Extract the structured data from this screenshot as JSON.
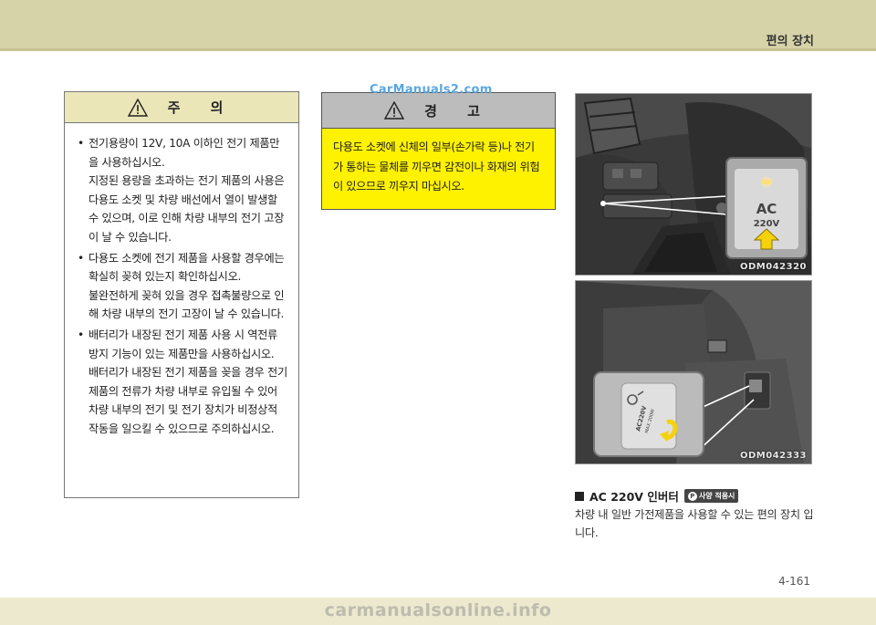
{
  "header": {
    "section_title": "편의 장치"
  },
  "caution": {
    "title": "주 의",
    "bullets": [
      {
        "paragraphs": [
          "전기용량이 12V, 10A 이하인 전기 제품만 을 사용하십시오.",
          "지정된 용량을 초과하는 전기 제품의 사용은 다용도 소켓 및 차량 배선에서 열이 발생할 수 있으며, 이로 인해 차량 내부의 전기 고장이 날 수 있습니다."
        ]
      },
      {
        "paragraphs": [
          "다용도 소켓에 전기 제품을 사용할 경우에는 확실히 꽂혀 있는지 확인하십시오.",
          "불완전하게 꽂혀 있을 경우 접촉불량으로 인해 차량 내부의 전기 고장이 날 수 있습니다."
        ]
      },
      {
        "paragraphs": [
          "배터리가 내장된 전기 제품 사용 시 역전류 방지 기능이 있는 제품만을 사용하십시오.",
          "배터리가 내장된 전기 제품을 꽂을 경우 전기 제품의 전류가 차량 내부로 유입될 수 있어 차량 내부의 전기 및 전기 장치가 비정상적 작동을 일으킬 수 있으므로 주의하십시오."
        ]
      }
    ]
  },
  "warning": {
    "title": "경 고",
    "text": "다용도 소켓에 신체의 일부(손가락 등)나 전기가 통하는 물체를 끼우면 감전이나 화재의 위험이 있으므로 끼우지 마십시오."
  },
  "photos": [
    {
      "code": "ODM042320",
      "button_label": "AC",
      "button_sub": "220V"
    },
    {
      "code": "ODM042333",
      "socket_label_1": "AC220V",
      "socket_label_2": "MAX 200W"
    }
  ],
  "feature": {
    "heading": "AC 220V 인버터",
    "badge": "사양 적용시",
    "badge_icon": "P",
    "description": "차량 내 일반 가전제품을 사용할 수 있는 편의 장치 입니다."
  },
  "page_number": "4-161",
  "watermarks": {
    "top": "CarManuals2.com",
    "bottom": "carmanualsonline.info"
  },
  "colors": {
    "caution_header": "#ebe6b8",
    "warning_header": "#bcbcbc",
    "warning_body": "#fff200",
    "top_band": "#d7d3a9",
    "arrow": "#f5d20b"
  }
}
